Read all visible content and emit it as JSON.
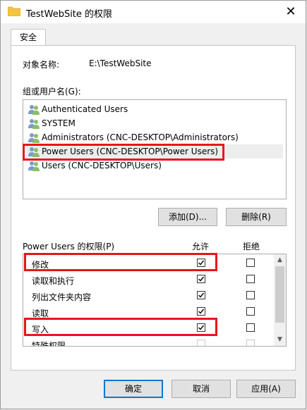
{
  "window": {
    "title": "TestWebSite 的权限",
    "close_glyph": "✕"
  },
  "tabs": [
    {
      "label": "安全"
    }
  ],
  "object": {
    "label": "对象名称:",
    "value": "E:\\TestWebSite"
  },
  "groups": {
    "label": "组或用户名(G):",
    "items": [
      {
        "label": "Authenticated Users"
      },
      {
        "label": "SYSTEM"
      },
      {
        "label": "Administrators (CNC-DESKTOP\\Administrators)"
      },
      {
        "label": "Power Users (CNC-DESKTOP\\Power Users)"
      },
      {
        "label": "Users (CNC-DESKTOP\\Users)"
      }
    ]
  },
  "buttons": {
    "add": "添加(D)...",
    "remove": "删除(R)"
  },
  "permissions": {
    "title": "Power Users 的权限(P)",
    "allow_header": "允许",
    "deny_header": "拒绝",
    "rows": [
      {
        "name": "修改",
        "allow": true,
        "deny": false
      },
      {
        "name": "读取和执行",
        "allow": true,
        "deny": false
      },
      {
        "name": "列出文件夹内容",
        "allow": true,
        "deny": false
      },
      {
        "name": "读取",
        "allow": true,
        "deny": false
      },
      {
        "name": "写入",
        "allow": true,
        "deny": false
      },
      {
        "name": "特殊权限",
        "allow": false,
        "deny": false
      }
    ]
  },
  "footer": {
    "ok": "确定",
    "cancel": "取消",
    "apply": "应用(A)"
  },
  "colors": {
    "highlight": "#e8141b",
    "primary_border": "#0078d7"
  }
}
